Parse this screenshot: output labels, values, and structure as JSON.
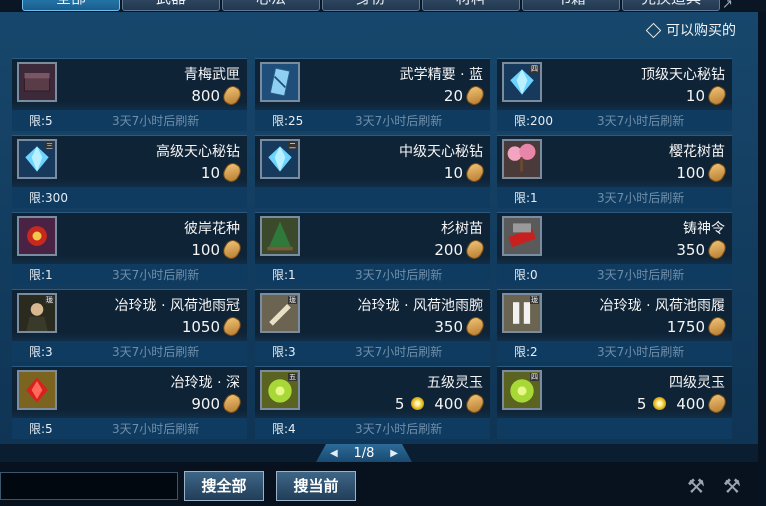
{
  "tabs": [
    {
      "label": "全部",
      "active": true
    },
    {
      "label": "武器"
    },
    {
      "label": "心法"
    },
    {
      "label": "身份"
    },
    {
      "label": "材料"
    },
    {
      "label": "书籍"
    },
    {
      "label": "兑换道具"
    }
  ],
  "filter": {
    "label": "可以购买的"
  },
  "items": [
    {
      "name": "青梅武匣",
      "price": "800",
      "limit": "限:5",
      "refresh": "3天7小时后刷新",
      "icon": "weapon-box-icon"
    },
    {
      "name": "武学精要 · 蓝",
      "price": "20",
      "limit": "限:25",
      "refresh": "3天7小时后刷新",
      "icon": "martial-scroll-icon"
    },
    {
      "name": "顶级天心秘钻",
      "price": "10",
      "limit": "限:200",
      "refresh": "3天7小时后刷新",
      "icon": "blue-diamond-icon",
      "grade": "四"
    },
    {
      "name": "高级天心秘钻",
      "price": "10",
      "limit": "限:300",
      "refresh": "",
      "icon": "blue-diamond-icon",
      "grade": "三"
    },
    {
      "name": "中级天心秘钻",
      "price": "10",
      "limit": "",
      "refresh": "",
      "icon": "blue-diamond-icon",
      "grade": "二"
    },
    {
      "name": "樱花树苗",
      "price": "100",
      "limit": "限:1",
      "refresh": "3天7小时后刷新",
      "icon": "sakura-tree-icon"
    },
    {
      "name": "彼岸花种",
      "price": "100",
      "limit": "限:1",
      "refresh": "3天7小时后刷新",
      "icon": "flower-seed-icon"
    },
    {
      "name": "杉树苗",
      "price": "200",
      "limit": "限:1",
      "refresh": "3天7小时后刷新",
      "icon": "fir-sapling-icon"
    },
    {
      "name": "铸神令",
      "price": "350",
      "limit": "限:0",
      "refresh": "3天7小时后刷新",
      "icon": "forge-token-icon"
    },
    {
      "name": "冶玲珑 · 风荷池雨冠",
      "price": "1050",
      "limit": "限:3",
      "refresh": "3天7小时后刷新",
      "icon": "rain-crown-icon",
      "grade": "珑"
    },
    {
      "name": "冶玲珑 · 风荷池雨腕",
      "price": "350",
      "limit": "限:3",
      "refresh": "3天7小时后刷新",
      "icon": "rain-bracer-icon",
      "grade": "珑"
    },
    {
      "name": "冶玲珑 · 风荷池雨履",
      "price": "1750",
      "limit": "限:2",
      "refresh": "3天7小时后刷新",
      "icon": "rain-boots-icon",
      "grade": "珑"
    },
    {
      "name": "冶玲珑 · 深",
      "price": "900",
      "limit": "限:5",
      "refresh": "3天7小时后刷新",
      "icon": "red-gem-icon"
    },
    {
      "name": "五级灵玉",
      "price": "400",
      "gold": "5",
      "limit": "限:4",
      "refresh": "3天7小时后刷新",
      "icon": "jade-icon",
      "grade": "五"
    },
    {
      "name": "四级灵玉",
      "price": "400",
      "gold": "5",
      "limit": "",
      "refresh": "",
      "icon": "jade-icon",
      "grade": "四"
    }
  ],
  "pager": {
    "label": "1/8"
  },
  "footer": {
    "search_all": "搜全部",
    "search_current": "搜当前"
  },
  "colors": {
    "panel": "#17476c",
    "card": "#0f2336",
    "accent": "#2c8fc6"
  }
}
